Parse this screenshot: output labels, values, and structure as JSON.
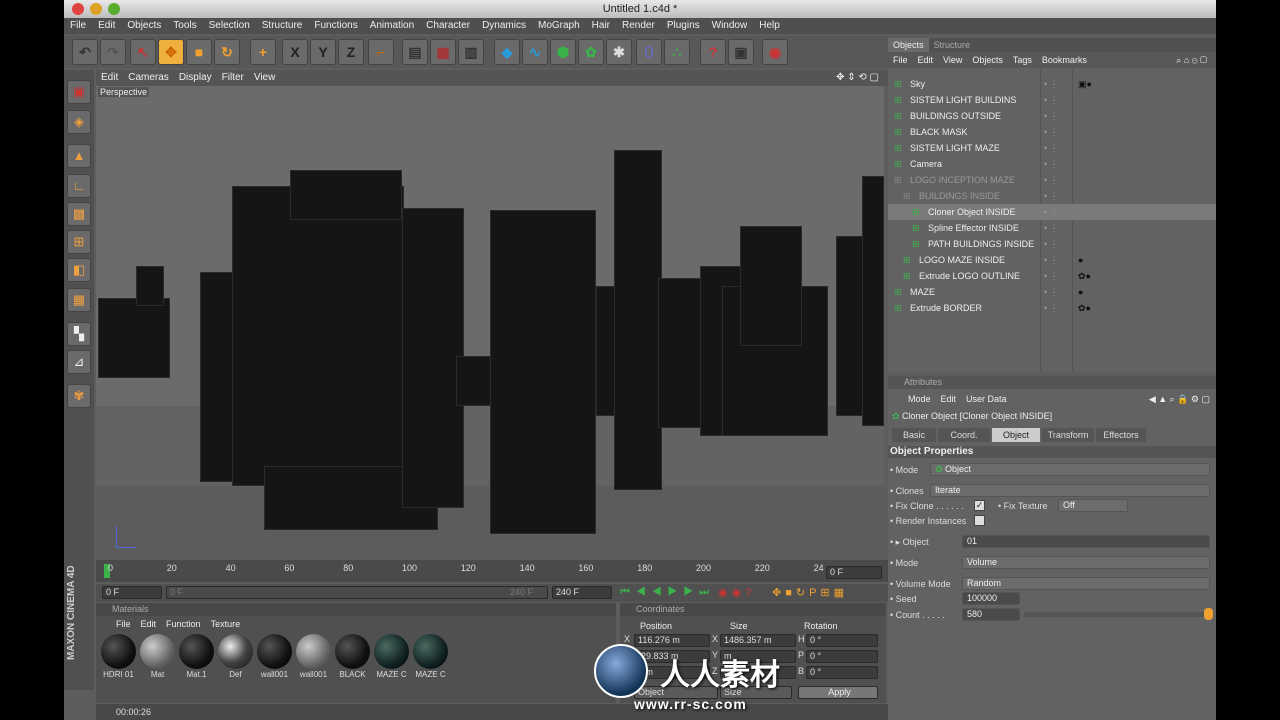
{
  "window": {
    "title": "Untitled 1.c4d *"
  },
  "menu": [
    "File",
    "Edit",
    "Objects",
    "Tools",
    "Selection",
    "Structure",
    "Functions",
    "Animation",
    "Character",
    "Dynamics",
    "MoGraph",
    "Hair",
    "Render",
    "Plugins",
    "Window",
    "Help"
  ],
  "toolbar": {
    "icons": [
      "undo-icon",
      "redo-icon",
      "select-icon",
      "move-icon",
      "scale-icon",
      "rotate-icon",
      "add-icon",
      "x-axis-icon",
      "y-axis-icon",
      "z-axis-icon",
      "coord-system-icon",
      "render-view-icon",
      "render-picture-icon",
      "render-settings-icon",
      "cube-icon",
      "spline-icon",
      "nurbs-icon",
      "array-icon",
      "deformer-icon",
      "scene-icon",
      "particle-icon",
      "help-icon",
      "film-icon",
      "render-globe-icon"
    ],
    "axis_labels": [
      "X",
      "Y",
      "Z"
    ]
  },
  "viewport": {
    "menu": [
      "Edit",
      "Cameras",
      "Display",
      "Filter",
      "View"
    ],
    "label": "Perspective"
  },
  "timeline": {
    "ticks": [
      "0",
      "20",
      "40",
      "60",
      "80",
      "100",
      "120",
      "140",
      "160",
      "180",
      "200",
      "220",
      "24"
    ],
    "current_frame": "0 F",
    "start": "0 F",
    "end": "240 F",
    "end2": "240 F",
    "slider_value": "0 F"
  },
  "materials": {
    "title": "Materials",
    "menu": [
      "File",
      "Edit",
      "Function",
      "Texture"
    ],
    "items": [
      "HDRI 01",
      "Mat",
      "Mat.1",
      "Def",
      "wall001",
      "wall001",
      "BLACK",
      "MAZE C",
      "MAZE C"
    ]
  },
  "coordinates": {
    "title": "Coordinates",
    "headers": [
      "Position",
      "Size",
      "Rotation"
    ],
    "rows": [
      {
        "axis": "X",
        "pos": "116.276 m",
        "saxis": "X",
        "size": "1486.357 m",
        "raxis": "H",
        "rot": "0 °"
      },
      {
        "axis": "Y",
        "pos": "-29.833 m",
        "saxis": "Y",
        "size": "m",
        "raxis": "P",
        "rot": "0 °"
      },
      {
        "axis": "Z",
        "pos": "0 m",
        "saxis": "Z",
        "size": "m",
        "raxis": "B",
        "rot": "0 °"
      }
    ],
    "mode1": "Object",
    "mode2": "Size",
    "apply": "Apply"
  },
  "objects": {
    "tabs": [
      "Objects",
      "Structure"
    ],
    "menu": [
      "File",
      "Edit",
      "View",
      "Objects",
      "Tags",
      "Bookmarks"
    ],
    "items": [
      {
        "name": "Sky",
        "indent": 0,
        "dim": false,
        "sel": false
      },
      {
        "name": "SISTEM LIGHT BUILDINS",
        "indent": 0,
        "dim": false,
        "sel": false
      },
      {
        "name": "BUILDINGS OUTSIDE",
        "indent": 0,
        "dim": false,
        "sel": false
      },
      {
        "name": "BLACK MASK",
        "indent": 0,
        "dim": false,
        "sel": false
      },
      {
        "name": "SISTEM LIGHT MAZE",
        "indent": 0,
        "dim": false,
        "sel": false
      },
      {
        "name": "Camera",
        "indent": 0,
        "dim": false,
        "sel": false
      },
      {
        "name": "LOGO INCEPTION MAZE",
        "indent": 0,
        "dim": true,
        "sel": false
      },
      {
        "name": "BUILDINGS INSIDE",
        "indent": 1,
        "dim": true,
        "sel": false
      },
      {
        "name": "Cloner Object INSIDE",
        "indent": 2,
        "dim": false,
        "sel": true
      },
      {
        "name": "Spline Effector INSIDE",
        "indent": 2,
        "dim": false,
        "sel": false
      },
      {
        "name": "PATH BUILDINGS INSIDE",
        "indent": 2,
        "dim": false,
        "sel": false
      },
      {
        "name": "LOGO MAZE INSIDE",
        "indent": 1,
        "dim": false,
        "sel": false
      },
      {
        "name": "Extrude LOGO OUTLINE",
        "indent": 1,
        "dim": false,
        "sel": false
      },
      {
        "name": "MAZE",
        "indent": 0,
        "dim": false,
        "sel": false
      },
      {
        "name": "Extrude BORDER",
        "indent": 0,
        "dim": false,
        "sel": false
      }
    ]
  },
  "attributes": {
    "title": "Attributes",
    "menu": [
      "Mode",
      "Edit",
      "User Data"
    ],
    "object_title": "Cloner Object [Cloner Object INSIDE]",
    "tabs": [
      "Basic",
      "Coord.",
      "Object",
      "Transform",
      "Effectors"
    ],
    "active_tab": "Object",
    "section": "Object Properties",
    "mode_label": "Mode",
    "mode_value": "Object",
    "clones_label": "Clones",
    "clones_value": "Iterate",
    "fix_clone_label": "Fix Clone",
    "fix_texture_label": "Fix Texture",
    "fix_texture_value": "Off",
    "render_instances_label": "Render Instances",
    "object_label": "Object",
    "object_value": "01",
    "mode2_label": "Mode",
    "mode2_value": "Volume",
    "volume_mode_label": "Volume Mode",
    "volume_mode_value": "Random",
    "seed_label": "Seed",
    "seed_value": "100000",
    "count_label": "Count",
    "count_value": "580"
  },
  "status": {
    "time": "00:00:26"
  },
  "branding": {
    "vertical": "MAXON CINEMA 4D",
    "watermark": "人人素材",
    "watermark_url": "www.rr-sc.com"
  }
}
